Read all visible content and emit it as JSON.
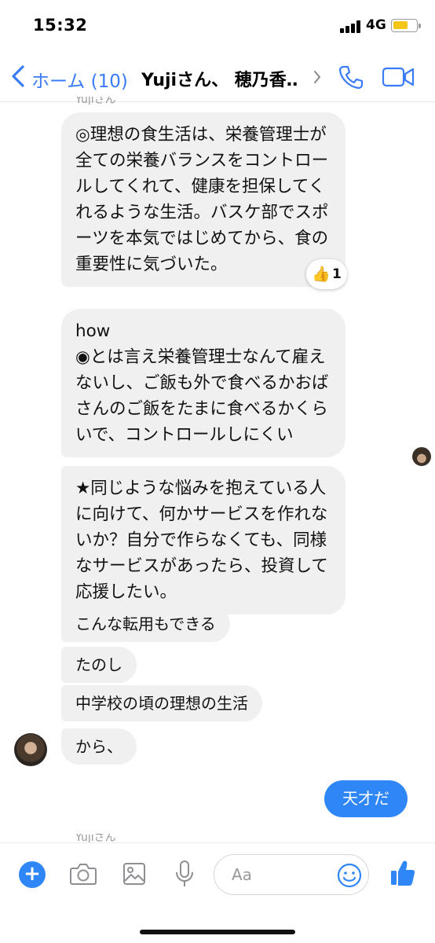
{
  "status_bar": {
    "time": "15:32",
    "network": "4G"
  },
  "header": {
    "back_label": "ホーム (10)",
    "title": "Yujiさん、 穂乃香…"
  },
  "messages": {
    "sender_name_top": "Yujiさん",
    "bubble_1": "◎理想の食生活は、栄養管理士が全ての栄養バランスをコントロールしてくれて、健康を担保してくれるような生活。バスケ部でスポーツを本気ではじめてから、食の重要性に気づいた。",
    "reaction": {
      "emoji": "👍",
      "count": "1"
    },
    "bubble_2_line1": "how",
    "bubble_2_line2": "◉とは言え栄養管理士なんて雇えないし、ご飯も外で食べるかおばさんのご飯をたまに食べるかくらいで、コントロールしにくい",
    "bubble_3": "★同じような悩みを抱えている人に向けて、何かサービスを作れないか？自分で作らなくても、同様なサービスがあったら、投資して応援したい。",
    "short_1": "こんな転用もできる",
    "short_2": "たのし",
    "short_3": "中学校の頃の理想の生活",
    "short_4": "から、",
    "outgoing_1": "天才だ",
    "sender_name_bottom": "Yujiさん"
  },
  "composer": {
    "placeholder": "Aa"
  },
  "colors": {
    "accent": "#2f86f6",
    "link": "#3a7cf7",
    "incoming_bubble": "#f0f0f0",
    "reaction": "#e8a920"
  },
  "icons": [
    "back-chevron-icon",
    "phone-icon",
    "video-camera-icon",
    "plus-icon",
    "camera-icon",
    "image-icon",
    "microphone-icon",
    "emoji-icon",
    "thumbs-up-icon"
  ]
}
